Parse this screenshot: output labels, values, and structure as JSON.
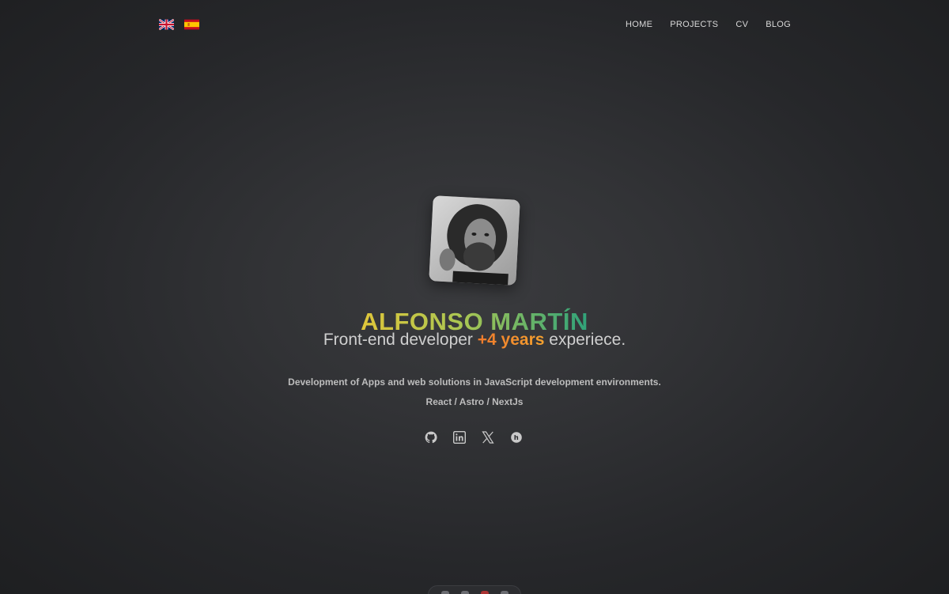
{
  "header": {
    "languages": [
      {
        "code": "en",
        "label": "English",
        "icon": "uk-flag-icon"
      },
      {
        "code": "es",
        "label": "Español",
        "icon": "spain-flag-icon"
      }
    ],
    "nav": {
      "home": "HOME",
      "projects": "PROJECTS",
      "cv": "CV",
      "blog": "BLOG"
    }
  },
  "hero": {
    "name": "ALFONSO MARTÍN",
    "tagline_prefix": "Front-end developer ",
    "tagline_highlight": "+4 years",
    "tagline_suffix": " experiece.",
    "description": "Development of Apps and web solutions in JavaScript development environments.",
    "stack": "React / Astro / NextJs"
  },
  "socials": [
    {
      "name": "GitHub",
      "icon": "github-icon"
    },
    {
      "name": "LinkedIn",
      "icon": "linkedin-icon"
    },
    {
      "name": "X",
      "icon": "x-icon"
    },
    {
      "name": "Blog",
      "icon": "hashnode-icon"
    }
  ],
  "colors": {
    "background": "#2b2c2f",
    "name_gradient_start": "#e0c63a",
    "name_gradient_end": "#2fa27a",
    "highlight": "#f08a2e",
    "text": "#cfcfcf"
  }
}
